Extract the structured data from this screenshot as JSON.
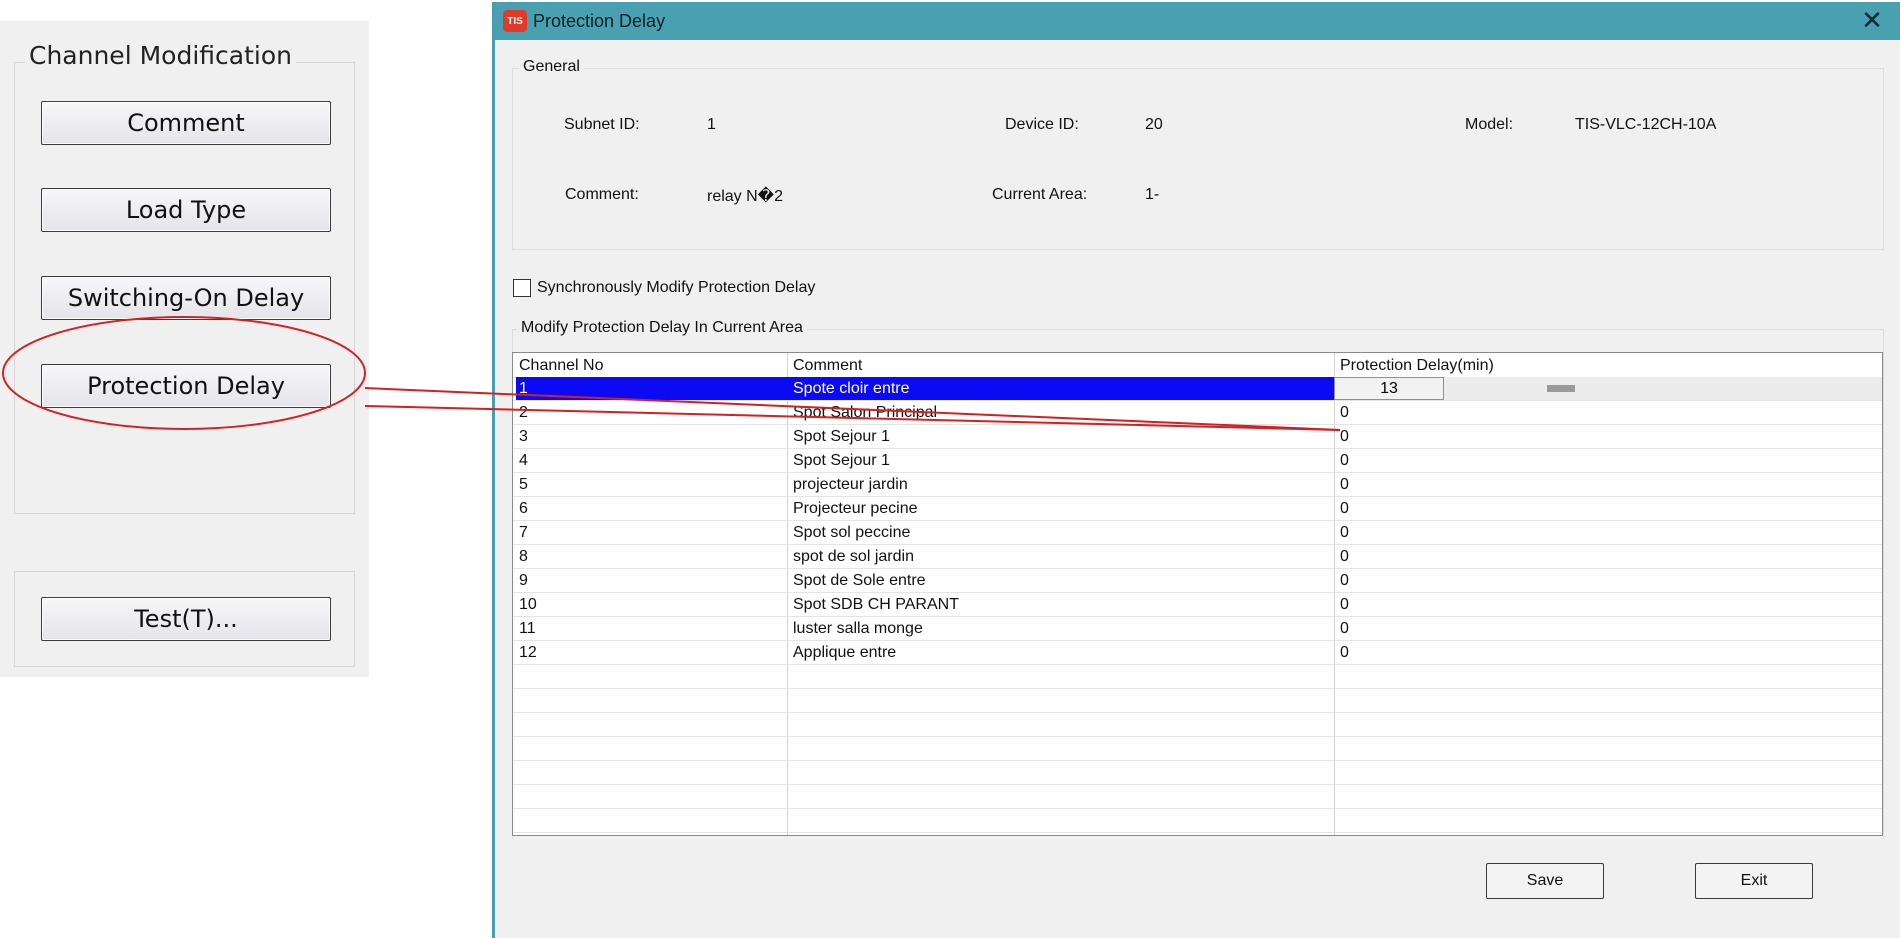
{
  "left_panel": {
    "group_title": "Channel Modification",
    "buttons": {
      "comment": "Comment",
      "load_type": "Load Type",
      "switching_on_delay": "Switching-On Delay",
      "protection_delay": "Protection Delay",
      "test": "Test(T)..."
    }
  },
  "dialog": {
    "title": "Protection Delay",
    "app_icon_text": "TIS",
    "close_glyph": "✕",
    "general": {
      "legend": "General",
      "subnet_id_label": "Subnet ID:",
      "subnet_id_value": "1",
      "device_id_label": "Device ID:",
      "device_id_value": "20",
      "model_label": "Model:",
      "model_value": "TIS-VLC-12CH-10A",
      "comment_label": "Comment:",
      "comment_value": "relay N�2",
      "current_area_label": "Current Area:",
      "current_area_value": "1-"
    },
    "sync_checkbox": {
      "label": "Synchronously Modify Protection Delay",
      "checked": false
    },
    "modify_section": {
      "legend": "Modify Protection Delay In Current Area"
    },
    "table": {
      "columns": [
        "Channel No",
        "Comment",
        "Protection Delay(min)"
      ],
      "rows": [
        {
          "channel": "1",
          "comment": "Spote cloir entre",
          "delay": "13"
        },
        {
          "channel": "2",
          "comment": "Spot Salon Principal",
          "delay": "0"
        },
        {
          "channel": "3",
          "comment": "Spot Sejour 1",
          "delay": "0"
        },
        {
          "channel": "4",
          "comment": "Spot Sejour 1",
          "delay": "0"
        },
        {
          "channel": "5",
          "comment": "projecteur jardin",
          "delay": "0"
        },
        {
          "channel": "6",
          "comment": "Projecteur pecine",
          "delay": "0"
        },
        {
          "channel": "7",
          "comment": "Spot sol peccine",
          "delay": "0"
        },
        {
          "channel": "8",
          "comment": "spot de sol jardin",
          "delay": "0"
        },
        {
          "channel": "9",
          "comment": "Spot de Sole entre",
          "delay": "0"
        },
        {
          "channel": "10",
          "comment": "Spot SDB CH PARANT",
          "delay": "0"
        },
        {
          "channel": "11",
          "comment": "luster salla monge",
          "delay": "0"
        },
        {
          "channel": "12",
          "comment": "Applique entre",
          "delay": "0"
        }
      ],
      "selected_row": 0,
      "empty_rows": 7
    },
    "buttons": {
      "save": "Save",
      "exit": "Exit"
    }
  },
  "colors": {
    "titlebar": "#49a0b1",
    "selection": "#0a0af4",
    "annotation": "#d42020"
  }
}
